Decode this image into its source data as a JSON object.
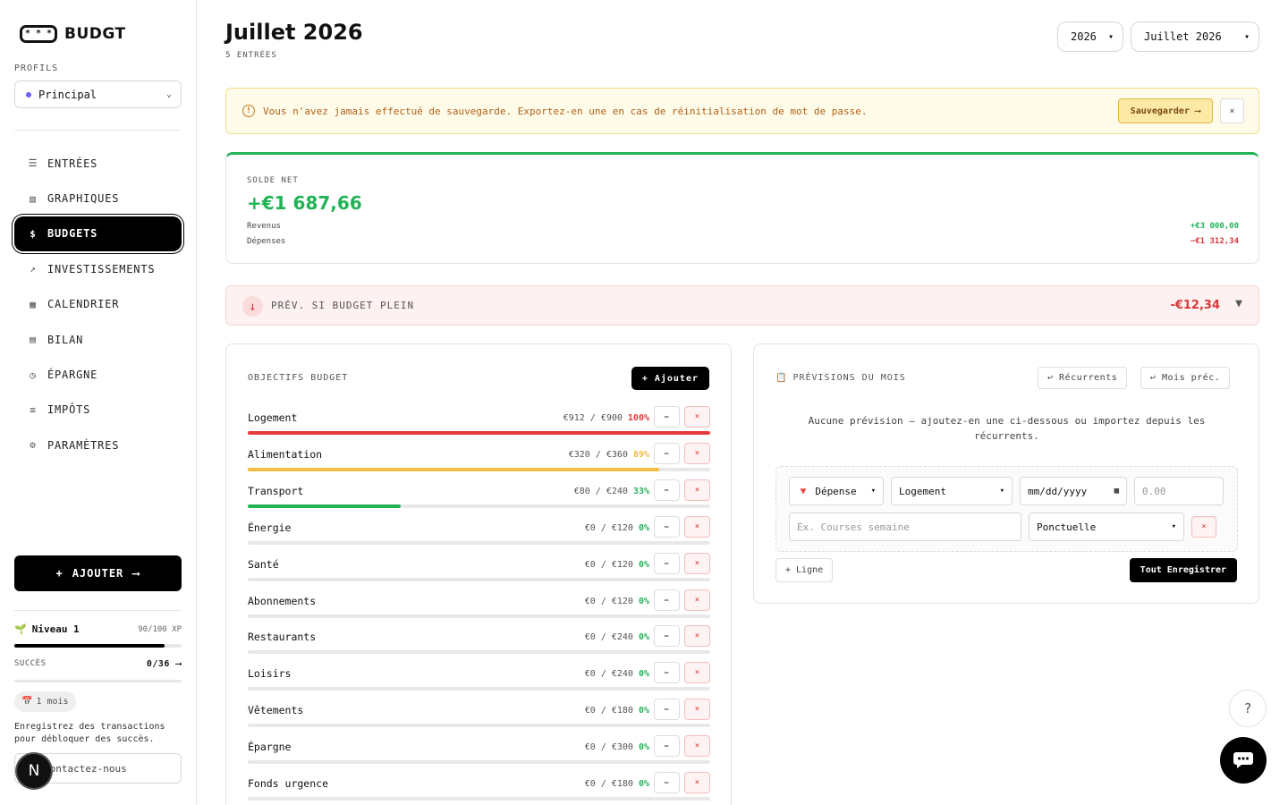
{
  "app": {
    "logo_glyphs": "* * *",
    "name": "BUDGT"
  },
  "sidebar": {
    "profiles_label": "PROFILS",
    "profile": "Principal",
    "nav": [
      {
        "label": "ENTRÉES",
        "icon": "list-icon"
      },
      {
        "label": "GRAPHIQUES",
        "icon": "bar-chart-icon"
      },
      {
        "label": "BUDGETS",
        "icon": "dollar-circle-icon",
        "active": true
      },
      {
        "label": "INVESTISSEMENTS",
        "icon": "trending-up-icon"
      },
      {
        "label": "CALENDRIER",
        "icon": "calendar-icon"
      },
      {
        "label": "BILAN",
        "icon": "document-icon"
      },
      {
        "label": "ÉPARGNE",
        "icon": "clock-icon"
      },
      {
        "label": "IMPÔTS",
        "icon": "receipt-icon"
      },
      {
        "label": "PARAMÈTRES",
        "icon": "gear-icon"
      }
    ],
    "add_label": "AJOUTER",
    "level_label": "Niveau 1",
    "xp": "90/100 XP",
    "xp_progress": 0.9,
    "succes_label": "SUCCÈS",
    "succes_count": "0/36",
    "mois_badge": "1 mois",
    "hint": "Enregistrez des transactions pour débloquer des succès.",
    "contact": "Contactez-nous",
    "n_badge": "N"
  },
  "header": {
    "title": "Juillet 2026",
    "subtitle": "5 ENTRÉES",
    "year_select": "2026",
    "month_select": "Juillet 2026"
  },
  "warning": {
    "text": "Vous n'avez jamais effectué de sauvegarde. Exportez-en une en cas de réinitialisation de mot de passe.",
    "save_label": "Sauvegarder",
    "close": "×"
  },
  "solde": {
    "label": "SOLDE NET",
    "value": "+€1 687,66",
    "revenus_label": "Revenus",
    "revenus_value": "+€3 000,00",
    "depenses_label": "Dépenses",
    "depenses_value": "−€1 312,34"
  },
  "prevision_plein": {
    "label": "PRÉV. SI BUDGET PLEIN",
    "value": "-€12,34",
    "toggle": "▼"
  },
  "budgets": {
    "title": "OBJECTIFS BUDGET",
    "add_label": "+ Ajouter",
    "edit_glyph": "✏",
    "delete_glyph": "×",
    "items": [
      {
        "name": "Logement",
        "amount": "€912 / €900",
        "pct": "100%",
        "progress": 1.0,
        "color": "#e5393b"
      },
      {
        "name": "Alimentation",
        "amount": "€320 / €360",
        "pct": "89%",
        "progress": 0.89,
        "color": "#f2bd42"
      },
      {
        "name": "Transport",
        "amount": "€80 / €240",
        "pct": "33%",
        "progress": 0.33,
        "color": "#22b357"
      },
      {
        "name": "Énergie",
        "amount": "€0 / €120",
        "pct": "0%",
        "progress": 0,
        "color": "#22b357"
      },
      {
        "name": "Santé",
        "amount": "€0 / €120",
        "pct": "0%",
        "progress": 0,
        "color": "#22b357"
      },
      {
        "name": "Abonnements",
        "amount": "€0 / €120",
        "pct": "0%",
        "progress": 0,
        "color": "#22b357"
      },
      {
        "name": "Restaurants",
        "amount": "€0 / €240",
        "pct": "0%",
        "progress": 0,
        "color": "#22b357"
      },
      {
        "name": "Loisirs",
        "amount": "€0 / €240",
        "pct": "0%",
        "progress": 0,
        "color": "#22b357"
      },
      {
        "name": "Vêtements",
        "amount": "€0 / €180",
        "pct": "0%",
        "progress": 0,
        "color": "#22b357"
      },
      {
        "name": "Épargne",
        "amount": "€0 / €300",
        "pct": "0%",
        "progress": 0,
        "color": "#22b357"
      },
      {
        "name": "Fonds urgence",
        "amount": "€0 / €180",
        "pct": "0%",
        "progress": 0,
        "color": "#22b357"
      }
    ]
  },
  "previsions": {
    "title": "PRÉVISIONS DU MOIS",
    "recurrents_label": "↩ Récurrents",
    "mois_prec_label": "↩ Mois préc.",
    "empty_text": "Aucune prévision — ajoutez-en une ci-dessous ou importez depuis les récurrents.",
    "type_value": "🔻 Dépense",
    "category_value": "Logement",
    "date_placeholder": "mm/dd/yyyy",
    "amount_placeholder": "0.00",
    "desc_placeholder": "Ex. Courses semaine",
    "frequency_value": "Ponctuelle",
    "delete_glyph": "×",
    "add_line_label": "+ Ligne",
    "save_all_label": "Tout Enregistrer"
  },
  "help_glyph": "?"
}
